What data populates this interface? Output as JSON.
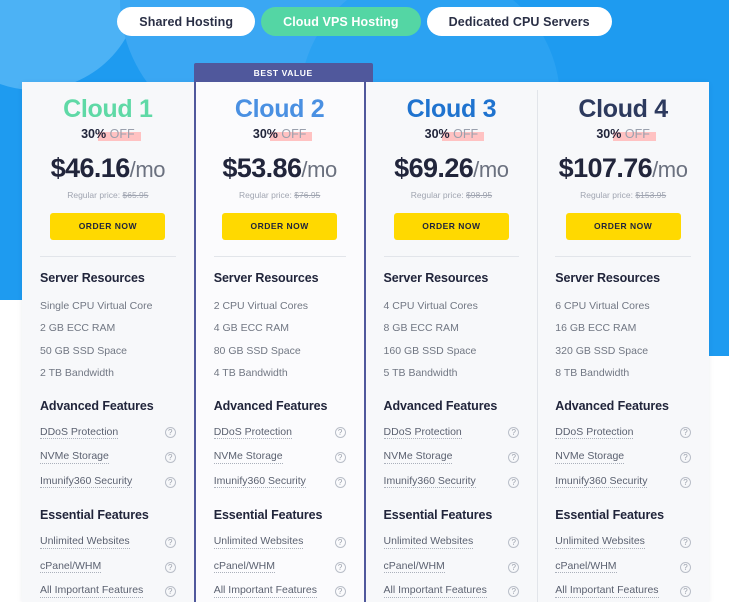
{
  "theme": {
    "background_blue": "#1e9bf0",
    "accent_green": "#54d6a4",
    "featured_border": "#50589c",
    "button_yellow": "#ffd900",
    "highlight_pink": "#ffc2c2",
    "card_background": "#f7f8fa"
  },
  "tabs": [
    {
      "label": "Shared Hosting",
      "active": false
    },
    {
      "label": "Cloud VPS Hosting",
      "active": true
    },
    {
      "label": "Dedicated CPU Servers",
      "active": false
    }
  ],
  "ribbon": {
    "label": "BEST VALUE"
  },
  "section_titles": {
    "resources": "Server Resources",
    "advanced": "Advanced Features",
    "essential": "Essential Features"
  },
  "tooltip_icon": "?",
  "order_label": "ORDER NOW",
  "regular_price_prefix": "Regular price:",
  "discount": {
    "percent": "30%",
    "word": "OFF"
  },
  "plans": [
    {
      "name": "Cloud 1",
      "name_color": "#5fd9a6",
      "featured": false,
      "price_amount": "$46.16",
      "price_period": "/mo",
      "regular_price": "$65.95",
      "resources": [
        "Single CPU Virtual Core",
        "2 GB ECC RAM",
        "50 GB SSD Space",
        "2 TB Bandwidth"
      ],
      "advanced_features": [
        "DDoS Protection",
        "NVMe Storage",
        "Imunify360 Security"
      ],
      "essential_features": [
        "Unlimited Websites",
        "cPanel/WHM",
        "All Important Features"
      ]
    },
    {
      "name": "Cloud 2",
      "name_color": "#4a90e2",
      "featured": true,
      "price_amount": "$53.86",
      "price_period": "/mo",
      "regular_price": "$76.95",
      "resources": [
        "2 CPU Virtual Cores",
        "4 GB ECC RAM",
        "80 GB SSD Space",
        "4 TB Bandwidth"
      ],
      "advanced_features": [
        "DDoS Protection",
        "NVMe Storage",
        "Imunify360 Security"
      ],
      "essential_features": [
        "Unlimited Websites",
        "cPanel/WHM",
        "All Important Features"
      ]
    },
    {
      "name": "Cloud 3",
      "name_color": "#1f73cf",
      "featured": false,
      "price_amount": "$69.26",
      "price_period": "/mo",
      "regular_price": "$98.95",
      "resources": [
        "4 CPU Virtual Cores",
        "8 GB ECC RAM",
        "160 GB SSD Space",
        "5 TB Bandwidth"
      ],
      "advanced_features": [
        "DDoS Protection",
        "NVMe Storage",
        "Imunify360 Security"
      ],
      "essential_features": [
        "Unlimited Websites",
        "cPanel/WHM",
        "All Important Features"
      ]
    },
    {
      "name": "Cloud 4",
      "name_color": "#2d3a5e",
      "featured": false,
      "price_amount": "$107.76",
      "price_period": "/mo",
      "regular_price": "$153.95",
      "resources": [
        "6 CPU Virtual Cores",
        "16 GB ECC RAM",
        "320 GB SSD Space",
        "8 TB Bandwidth"
      ],
      "advanced_features": [
        "DDoS Protection",
        "NVMe Storage",
        "Imunify360 Security"
      ],
      "essential_features": [
        "Unlimited Websites",
        "cPanel/WHM",
        "All Important Features"
      ]
    }
  ]
}
